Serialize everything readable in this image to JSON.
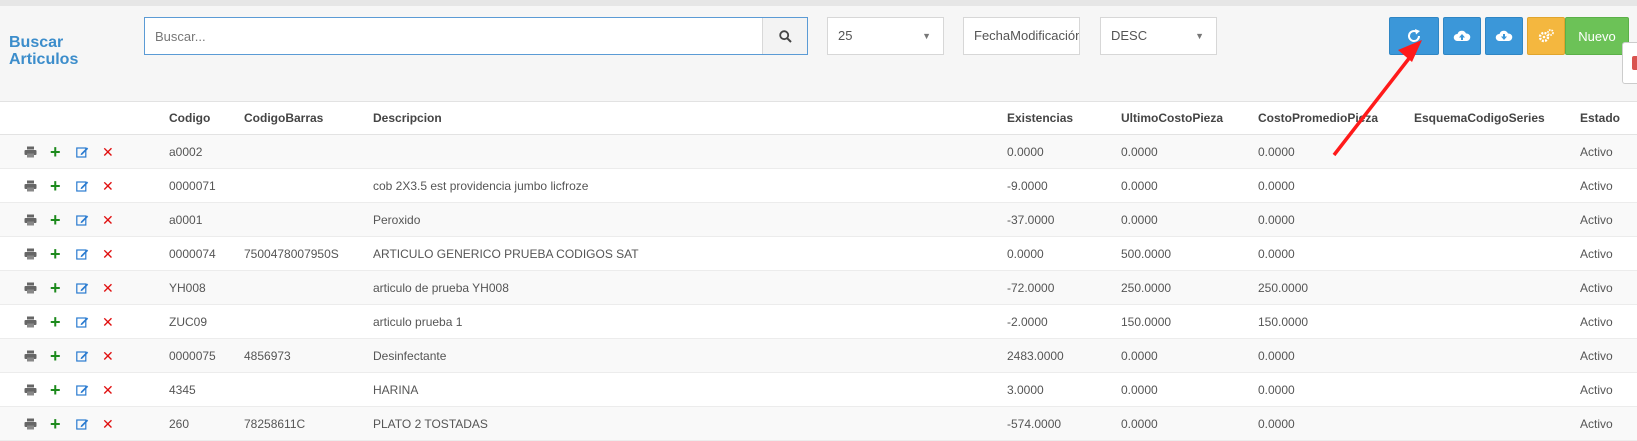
{
  "header": {
    "title_line1": "Buscar",
    "title_line2": "Articulos",
    "search_placeholder": "Buscar...",
    "page_size": "25",
    "order_field": "FechaModificación",
    "order_dir": "DESC",
    "new_label": "Nuevo",
    "icons": [
      "refresh-icon",
      "cloud-upload-icon",
      "cloud-download-icon",
      "gears-icon"
    ]
  },
  "table": {
    "columns": [
      "Codigo",
      "CodigoBarras",
      "Descripcion",
      "Existencias",
      "UltimoCostoPieza",
      "CostoPromedioPieza",
      "EsquemaCodigoSeries",
      "Estado"
    ],
    "rows": [
      [
        "a0002",
        "",
        "",
        "0.0000",
        "0.0000",
        "0.0000",
        "",
        "Activo"
      ],
      [
        "0000071",
        "",
        "cob 2X3.5 est providencia jumbo licfroze",
        "-9.0000",
        "0.0000",
        "0.0000",
        "",
        "Activo"
      ],
      [
        "a0001",
        "",
        "Peroxido",
        "-37.0000",
        "0.0000",
        "0.0000",
        "",
        "Activo"
      ],
      [
        "0000074",
        "7500478007950S",
        "ARTICULO GENERICO PRUEBA CODIGOS SAT",
        "0.0000",
        "500.0000",
        "0.0000",
        "",
        "Activo"
      ],
      [
        "YH008",
        "",
        "articulo de prueba YH008",
        "-72.0000",
        "250.0000",
        "250.0000",
        "",
        "Activo"
      ],
      [
        "ZUC09",
        "",
        "articulo prueba 1",
        "-2.0000",
        "150.0000",
        "150.0000",
        "",
        "Activo"
      ],
      [
        "0000075",
        "4856973",
        "Desinfectante",
        "2483.0000",
        "0.0000",
        "0.0000",
        "",
        "Activo"
      ],
      [
        "4345",
        "",
        "HARINA",
        "3.0000",
        "0.0000",
        "0.0000",
        "",
        "Activo"
      ],
      [
        "260",
        "78258611C",
        "PLATO 2 TOSTADAS",
        "-574.0000",
        "0.0000",
        "0.0000",
        "",
        "Activo"
      ]
    ]
  }
}
